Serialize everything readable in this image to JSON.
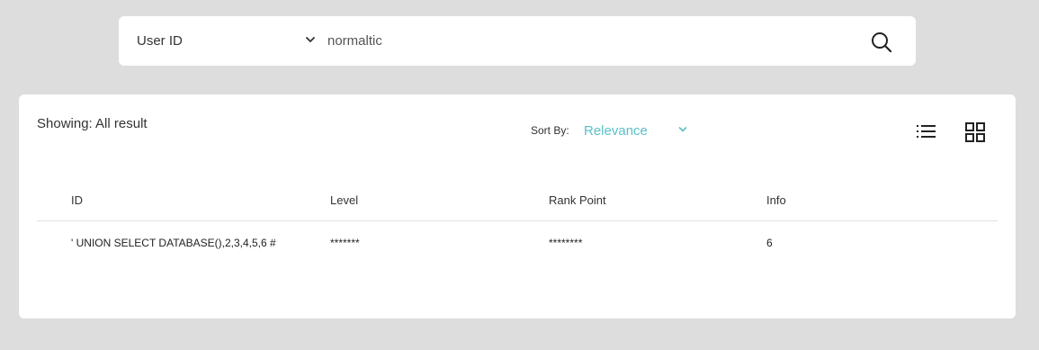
{
  "search": {
    "type_label": "User ID",
    "query": "normaltic"
  },
  "results": {
    "showing_text": "Showing: All result",
    "sort_label": "Sort By:",
    "sort_value": "Relevance",
    "columns": {
      "id": "ID",
      "level": "Level",
      "rank_point": "Rank Point",
      "info": "Info"
    },
    "rows": [
      {
        "id": "' UNION SELECT DATABASE(),2,3,4,5,6 #",
        "level": "*******",
        "rank_point": "********",
        "info": "6"
      }
    ]
  },
  "icons": {
    "search": "search-icon",
    "list_view": "list-view-icon",
    "grid_view": "grid-view-icon",
    "chevron": "chevron-down-icon"
  },
  "colors": {
    "accent": "#5bc0c8",
    "background": "#dddddd",
    "panel": "#ffffff"
  }
}
